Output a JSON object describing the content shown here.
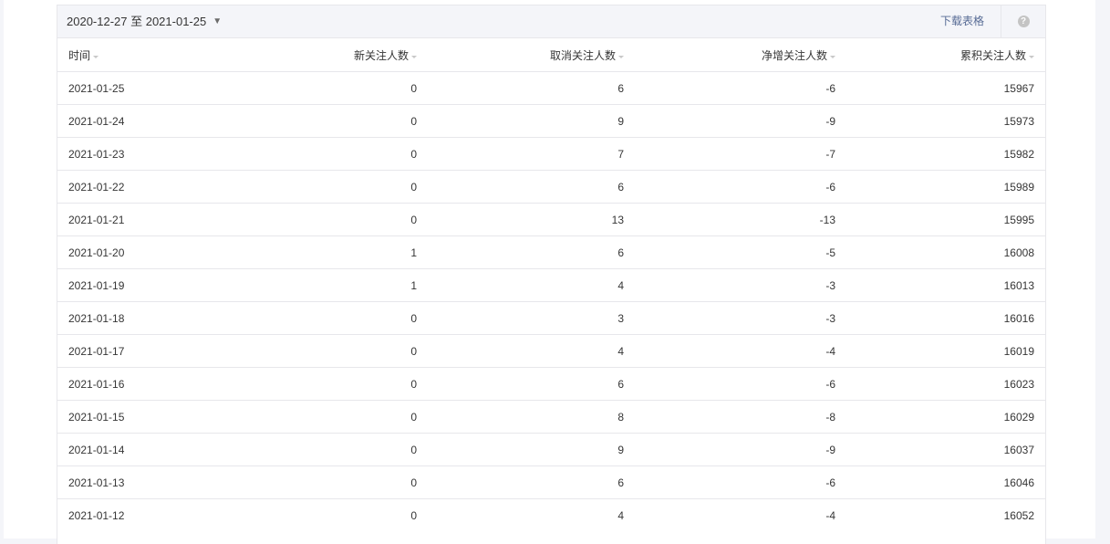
{
  "toolbar": {
    "date_range": "2020-12-27 至 2021-01-25",
    "dropdown_glyph": "▼",
    "download_label": "下载表格",
    "help_glyph": "?"
  },
  "table": {
    "headers": {
      "date": "时间",
      "new_follow": "新关注人数",
      "cancel_follow": "取消关注人数",
      "net_follow": "净增关注人数",
      "total_follow": "累积关注人数"
    },
    "rows": [
      {
        "date": "2021-01-25",
        "new": "0",
        "cancel": "6",
        "net": "-6",
        "total": "15967"
      },
      {
        "date": "2021-01-24",
        "new": "0",
        "cancel": "9",
        "net": "-9",
        "total": "15973"
      },
      {
        "date": "2021-01-23",
        "new": "0",
        "cancel": "7",
        "net": "-7",
        "total": "15982"
      },
      {
        "date": "2021-01-22",
        "new": "0",
        "cancel": "6",
        "net": "-6",
        "total": "15989"
      },
      {
        "date": "2021-01-21",
        "new": "0",
        "cancel": "13",
        "net": "-13",
        "total": "15995"
      },
      {
        "date": "2021-01-20",
        "new": "1",
        "cancel": "6",
        "net": "-5",
        "total": "16008"
      },
      {
        "date": "2021-01-19",
        "new": "1",
        "cancel": "4",
        "net": "-3",
        "total": "16013"
      },
      {
        "date": "2021-01-18",
        "new": "0",
        "cancel": "3",
        "net": "-3",
        "total": "16016"
      },
      {
        "date": "2021-01-17",
        "new": "0",
        "cancel": "4",
        "net": "-4",
        "total": "16019"
      },
      {
        "date": "2021-01-16",
        "new": "0",
        "cancel": "6",
        "net": "-6",
        "total": "16023"
      },
      {
        "date": "2021-01-15",
        "new": "0",
        "cancel": "8",
        "net": "-8",
        "total": "16029"
      },
      {
        "date": "2021-01-14",
        "new": "0",
        "cancel": "9",
        "net": "-9",
        "total": "16037"
      },
      {
        "date": "2021-01-13",
        "new": "0",
        "cancel": "6",
        "net": "-6",
        "total": "16046"
      },
      {
        "date": "2021-01-12",
        "new": "0",
        "cancel": "4",
        "net": "-4",
        "total": "16052"
      }
    ]
  },
  "colors": {
    "link": "#576b95",
    "toolbar_bg": "#f4f5f9",
    "border": "#e7e7eb",
    "text": "#353535"
  }
}
